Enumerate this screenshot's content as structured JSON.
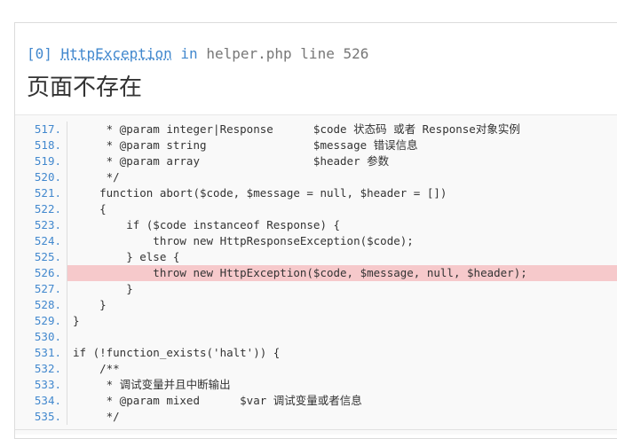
{
  "exception": {
    "index": "[0]",
    "name": "HttpException",
    "in_word": "in",
    "file": "helper.php",
    "line_word": "line",
    "line": "526"
  },
  "title": "页面不存在",
  "source": {
    "highlight_line": "526",
    "lines": [
      {
        "no": "517.",
        "text": "     * @param integer|Response      $code 状态码 或者 Response对象实例"
      },
      {
        "no": "518.",
        "text": "     * @param string                $message 错误信息"
      },
      {
        "no": "519.",
        "text": "     * @param array                 $header 参数"
      },
      {
        "no": "520.",
        "text": "     */"
      },
      {
        "no": "521.",
        "text": "    function abort($code, $message = null, $header = [])"
      },
      {
        "no": "522.",
        "text": "    {"
      },
      {
        "no": "523.",
        "text": "        if ($code instanceof Response) {"
      },
      {
        "no": "524.",
        "text": "            throw new HttpResponseException($code);"
      },
      {
        "no": "525.",
        "text": "        } else {"
      },
      {
        "no": "526.",
        "text": "            throw new HttpException($code, $message, null, $header);"
      },
      {
        "no": "527.",
        "text": "        }"
      },
      {
        "no": "528.",
        "text": "    }"
      },
      {
        "no": "529.",
        "text": "}"
      },
      {
        "no": "530.",
        "text": ""
      },
      {
        "no": "531.",
        "text": "if (!function_exists('halt')) {"
      },
      {
        "no": "532.",
        "text": "    /**"
      },
      {
        "no": "533.",
        "text": "     * 调试变量并且中断输出"
      },
      {
        "no": "534.",
        "text": "     * @param mixed      $var 调试变量或者信息"
      },
      {
        "no": "535.",
        "text": "     */"
      }
    ]
  }
}
